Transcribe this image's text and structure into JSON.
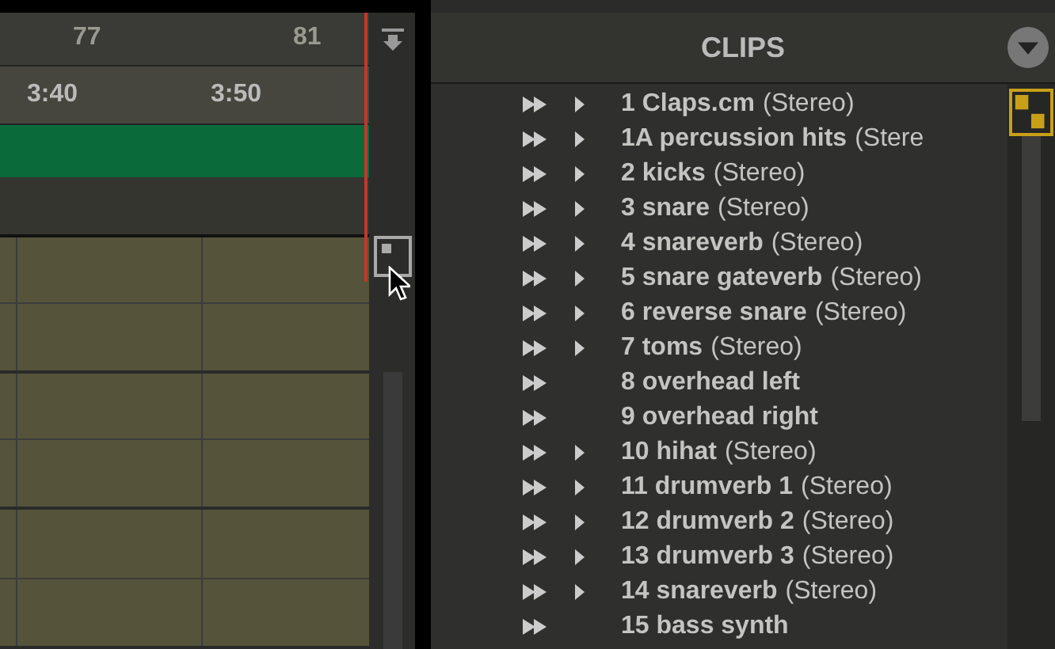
{
  "timeline": {
    "bars": [
      {
        "label": "77"
      },
      {
        "label": "81"
      }
    ],
    "times": [
      {
        "label": "3:40"
      },
      {
        "label": "3:50"
      }
    ]
  },
  "clips": {
    "title": "CLIPS",
    "rows": [
      {
        "name": "1 Claps.cm",
        "suffix": "(Stereo)",
        "expandable": true
      },
      {
        "name": "1A percussion hits",
        "suffix": "(Stere",
        "expandable": true
      },
      {
        "name": "2 kicks",
        "suffix": "(Stereo)",
        "expandable": true
      },
      {
        "name": "3 snare",
        "suffix": "(Stereo)",
        "expandable": true
      },
      {
        "name": "4 snareverb",
        "suffix": "(Stereo)",
        "expandable": true
      },
      {
        "name": "5 snare gateverb",
        "suffix": "(Stereo)",
        "expandable": true
      },
      {
        "name": "6 reverse snare",
        "suffix": "(Stereo)",
        "expandable": true
      },
      {
        "name": "7 toms",
        "suffix": "(Stereo)",
        "expandable": true
      },
      {
        "name": "8 overhead left",
        "expandable": false
      },
      {
        "name": "9 overhead right",
        "expandable": false
      },
      {
        "name": "10 hihat",
        "suffix": "(Stereo)",
        "expandable": true
      },
      {
        "name": "11 drumverb 1",
        "suffix": "(Stereo)",
        "expandable": true
      },
      {
        "name": "12 drumverb 2",
        "suffix": "(Stereo)",
        "expandable": true
      },
      {
        "name": "13 drumverb 3",
        "suffix": "(Stereo)",
        "expandable": true
      },
      {
        "name": "14 snareverb",
        "suffix": "(Stereo)",
        "expandable": true
      },
      {
        "name": "15 bass synth",
        "expandable": false
      }
    ]
  }
}
